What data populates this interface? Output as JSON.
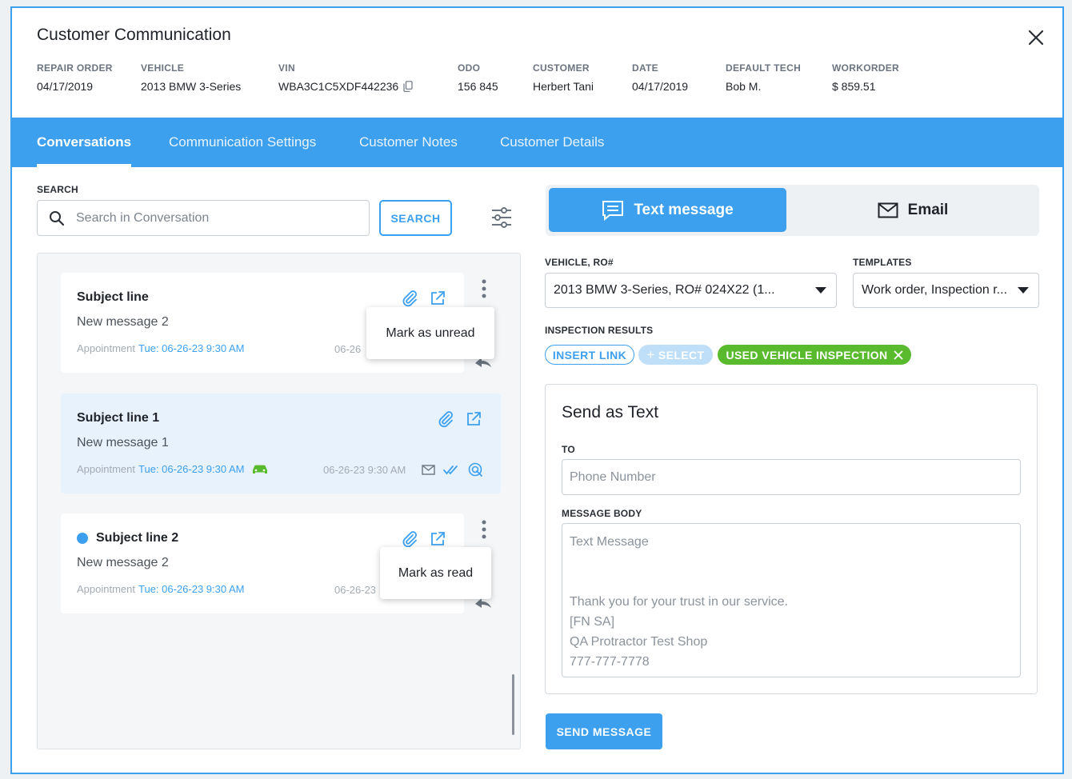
{
  "header": {
    "title": "Customer Communication",
    "meta": [
      {
        "label": "REPAIR ORDER",
        "value": "04/17/2019"
      },
      {
        "label": "VEHICLE",
        "value": "2013 BMW 3-Series"
      },
      {
        "label": "VIN",
        "value": "WBA3C1C5XDF442236"
      },
      {
        "label": "ODO",
        "value": "156 845"
      },
      {
        "label": "CUSTOMER",
        "value": "Herbert Tani"
      },
      {
        "label": "DATE",
        "value": "04/17/2019"
      },
      {
        "label": "DEFAULT TECH",
        "value": "Bob M."
      },
      {
        "label": "WORKORDER",
        "value": "$ 859.51"
      }
    ]
  },
  "tabs": [
    "Conversations",
    "Communication Settings",
    "Customer Notes",
    "Customer Details"
  ],
  "search": {
    "label": "SEARCH",
    "placeholder": "Search in Conversation",
    "button": "SEARCH"
  },
  "conversations": [
    {
      "subject": "Subject line",
      "message": "New message 2",
      "appt_label": "Appointment",
      "appt_date": "Tue: 06-26-23 9:30 AM",
      "timestamp": "06-26",
      "menu_item": "Mark as unread"
    },
    {
      "subject": "Subject line 1",
      "message": "New message 1",
      "appt_label": "Appointment",
      "appt_date": "Tue: 06-26-23 9:30 AM",
      "timestamp": "06-26-23 9:30 AM"
    },
    {
      "subject": "Subject line 2",
      "message": "New message 2",
      "appt_label": "Appointment",
      "appt_date": "Tue: 06-26-23 9:30 AM",
      "timestamp": "06-26-23",
      "menu_item": "Mark as read"
    }
  ],
  "compose": {
    "modes": {
      "text": "Text message",
      "email": "Email"
    },
    "vehicle_label": "VEHICLE, RO#",
    "vehicle_value": "2013 BMW 3-Series, RO# 024X22 (1...",
    "templates_label": "TEMPLATES",
    "templates_value": "Work order, Inspection r...",
    "inspection_label": "INSPECTION RESULTS",
    "insert_link": "INSERT LINK",
    "select": "SELECT",
    "inspection_chip": "USED VEHICLE INSPECTION",
    "send_title": "Send as Text",
    "to_label": "TO",
    "to_placeholder": "Phone Number",
    "body_label": "MESSAGE BODY",
    "body_text": "Text Message\n\n\nThank you for your trust in our service.\n[FN SA]\nQA Protractor Test Shop\n777-777-7778",
    "send_button": "SEND MESSAGE"
  },
  "colors": {
    "accent": "#3da0ef",
    "success": "#5aba2e"
  }
}
